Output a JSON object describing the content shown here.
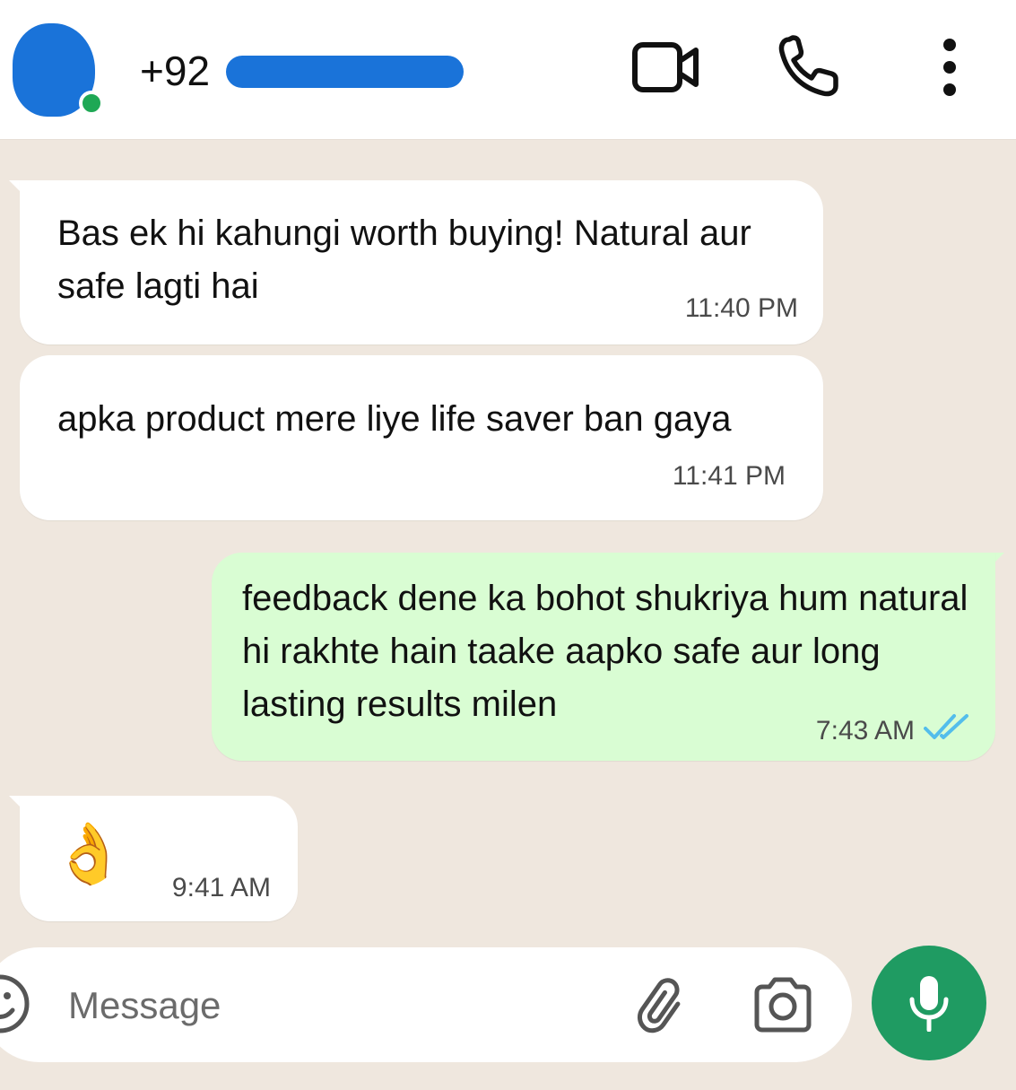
{
  "header": {
    "contact_prefix": "+92",
    "status": "online",
    "colors": {
      "avatar": "#1a73d9",
      "online": "#1fa855",
      "redaction": "#1a73d9"
    },
    "icons": [
      "video-call-icon",
      "voice-call-icon",
      "more-options-icon"
    ]
  },
  "messages": [
    {
      "direction": "incoming",
      "text": "Bas ek hi kahungi worth buying! Natural aur safe lagti hai",
      "time": "11:40 PM"
    },
    {
      "direction": "incoming",
      "text": "apka product mere liye life saver ban gaya",
      "time": "11:41 PM"
    },
    {
      "direction": "outgoing",
      "text": "feedback dene ka bohot shukriya hum natural hi rakhte hain taake aapko safe aur long lasting results milen",
      "time": "7:43 AM",
      "status": "read"
    },
    {
      "direction": "incoming",
      "text": "👌",
      "time": "9:41 AM"
    }
  ],
  "composer": {
    "placeholder": "Message",
    "icons": [
      "emoji-icon",
      "attachment-icon",
      "camera-icon",
      "microphone-icon"
    ],
    "colors": {
      "mic_button": "#1f9b62",
      "outgoing_bubble": "#d9fdd3",
      "read_ticks": "#53bdeb"
    }
  }
}
